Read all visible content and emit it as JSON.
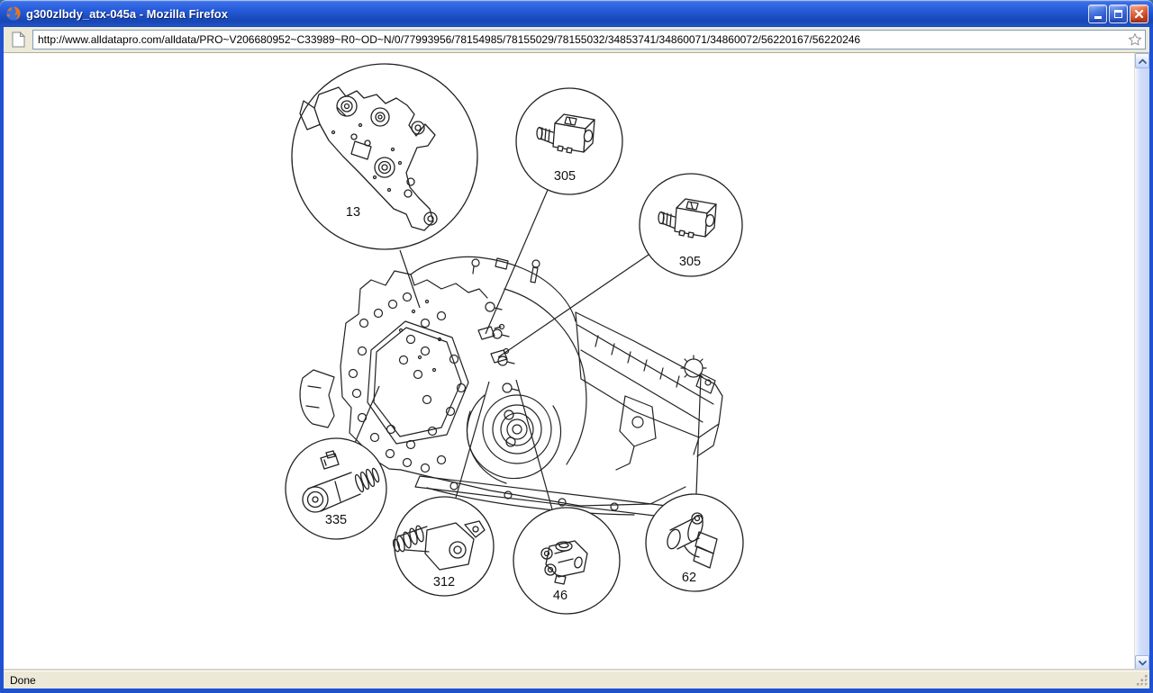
{
  "window": {
    "title": "g300zlbdy_atx-045a - Mozilla Firefox",
    "status_text": "Done"
  },
  "address_bar": {
    "url": "http://www.alldatapro.com/alldata/PRO~V206680952~C33989~R0~OD~N/0/77993956/78154985/78155029/78155032/34853741/34860071/34860072/56220167/56220246"
  },
  "diagram": {
    "description": "Automatic transaxle solenoid and sensor location exploded-callout line drawing",
    "callouts": [
      {
        "label": "13"
      },
      {
        "label": "305"
      },
      {
        "label": "305"
      },
      {
        "label": "335"
      },
      {
        "label": "312"
      },
      {
        "label": "46"
      },
      {
        "label": "62"
      }
    ]
  },
  "icons": {
    "firefox_logo": "firefox-logo",
    "page_icon": "page-icon",
    "bookmark_star": "bookmark-star-icon"
  },
  "colors": {
    "titlebar_blue": "#2459d8",
    "window_border_blue": "#1e52d2",
    "chrome_beige": "#ece9d8",
    "close_red": "#c23c1b",
    "drawing_ink": "#222222"
  }
}
